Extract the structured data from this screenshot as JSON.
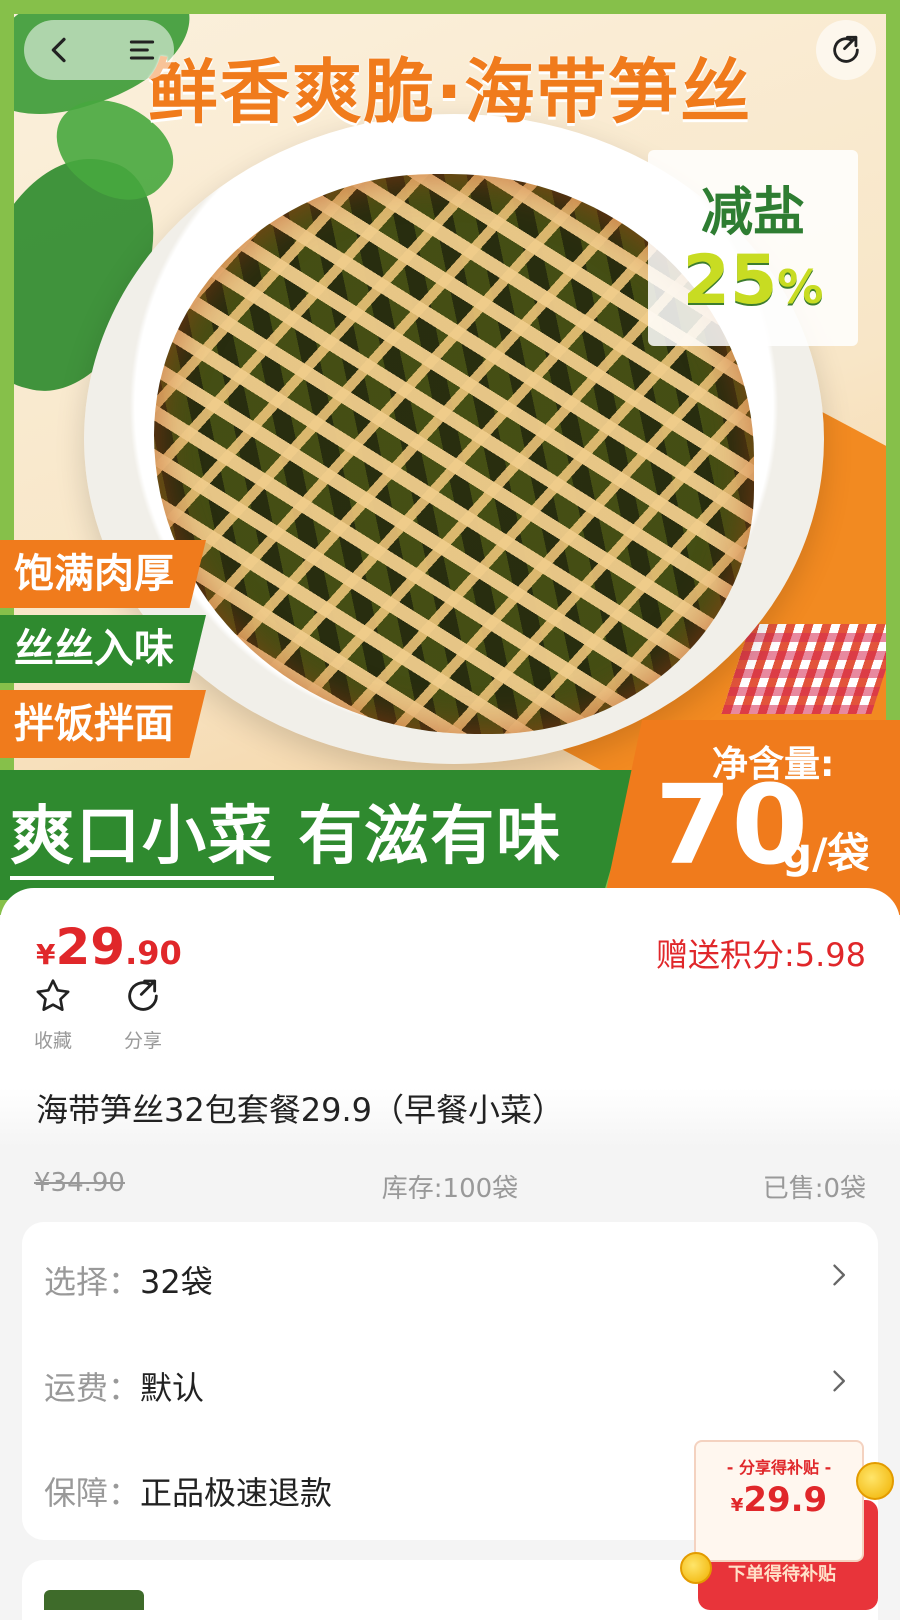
{
  "hero": {
    "title": "鲜香爽脆·海带笋丝",
    "salt_label": "减盐",
    "salt_value": "25",
    "salt_pct": "%",
    "tags": [
      "饱满肉厚",
      "丝丝入味",
      "拌饭拌面"
    ],
    "slogan_underlined": "爽口小菜",
    "slogan_rest": "有滋有味",
    "net_label": "净含量:",
    "net_value": "70",
    "net_unit": "g/袋"
  },
  "nav": {
    "back_icon": "chevron-left-icon",
    "menu_icon": "menu-icon",
    "share_icon": "share-icon"
  },
  "price": {
    "symbol": "¥",
    "integer": "29",
    "decimal": ".90"
  },
  "points": "赠送积分:5.98",
  "actions": {
    "favorite": "收藏",
    "share": "分享"
  },
  "product_title": "海带笋丝32包套餐29.9（早餐小菜）",
  "meta": {
    "original_price": "¥34.90",
    "stock": "库存:100袋",
    "sold": "已售:0袋"
  },
  "options": [
    {
      "key": "选择：",
      "value": "32袋"
    },
    {
      "key": "运费：",
      "value": "默认"
    },
    {
      "key": "保障：",
      "value": "正品极速退款"
    }
  ],
  "subsidy": {
    "title": "- 分享得补贴 -",
    "symbol": "¥",
    "amount": "29.9",
    "footer": "下单得待补贴"
  },
  "colors": {
    "accent_red": "#e0272a",
    "brand_orange": "#f07b1c",
    "brand_green": "#2f8a2f"
  }
}
